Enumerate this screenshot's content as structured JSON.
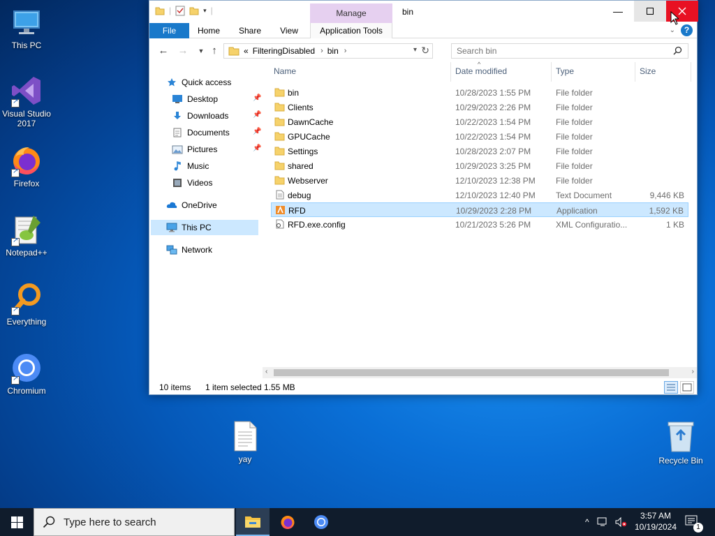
{
  "desktop": {
    "icons": [
      {
        "label": "This PC",
        "icon": "computer-icon"
      },
      {
        "label": "Visual Studio 2017",
        "icon": "visual-studio-icon"
      },
      {
        "label": "Firefox",
        "icon": "firefox-icon"
      },
      {
        "label": "Notepad++",
        "icon": "notepadpp-icon"
      },
      {
        "label": "Everything",
        "icon": "everything-search-icon"
      },
      {
        "label": "Chromium",
        "icon": "chromium-icon"
      }
    ],
    "yay_label": "yay",
    "recycle_label": "Recycle Bin"
  },
  "window": {
    "title": "bin",
    "manage_label": "Manage",
    "tabs": {
      "file": "File",
      "home": "Home",
      "share": "Share",
      "view": "View",
      "app_tools": "Application Tools"
    },
    "help_label": "?",
    "breadcrumb": {
      "prefix": "«",
      "items": [
        "FilteringDisabled",
        "bin"
      ]
    },
    "search_placeholder": "Search bin",
    "nav": {
      "quick_access": "Quick access",
      "desktop": "Desktop",
      "downloads": "Downloads",
      "documents": "Documents",
      "pictures": "Pictures",
      "music": "Music",
      "videos": "Videos",
      "onedrive": "OneDrive",
      "this_pc": "This PC",
      "network": "Network"
    },
    "columns": {
      "name": "Name",
      "date": "Date modified",
      "type": "Type",
      "size": "Size"
    },
    "files": [
      {
        "name": "bin",
        "date": "10/28/2023 1:55 PM",
        "type": "File folder",
        "size": "",
        "icon": "folder-icon"
      },
      {
        "name": "Clients",
        "date": "10/29/2023 2:26 PM",
        "type": "File folder",
        "size": "",
        "icon": "folder-icon"
      },
      {
        "name": "DawnCache",
        "date": "10/22/2023 1:54 PM",
        "type": "File folder",
        "size": "",
        "icon": "folder-icon"
      },
      {
        "name": "GPUCache",
        "date": "10/22/2023 1:54 PM",
        "type": "File folder",
        "size": "",
        "icon": "folder-icon"
      },
      {
        "name": "Settings",
        "date": "10/28/2023 2:07 PM",
        "type": "File folder",
        "size": "",
        "icon": "folder-icon"
      },
      {
        "name": "shared",
        "date": "10/29/2023 3:25 PM",
        "type": "File folder",
        "size": "",
        "icon": "folder-icon"
      },
      {
        "name": "Webserver",
        "date": "12/10/2023 12:38 PM",
        "type": "File folder",
        "size": "",
        "icon": "folder-icon"
      },
      {
        "name": "debug",
        "date": "12/10/2023 12:40 PM",
        "type": "Text Document",
        "size": "9,446 KB",
        "icon": "text-document-icon"
      },
      {
        "name": "RFD",
        "date": "10/29/2023 2:28 PM",
        "type": "Application",
        "size": "1,592 KB",
        "icon": "application-icon",
        "selected": true
      },
      {
        "name": "RFD.exe.config",
        "date": "10/21/2023 5:26 PM",
        "type": "XML Configuratio...",
        "size": "1 KB",
        "icon": "config-file-icon"
      }
    ],
    "status": {
      "items": "10 items",
      "selected": "1 item selected",
      "size": "1.55 MB"
    }
  },
  "taskbar": {
    "search_placeholder": "Type here to search",
    "time": "3:57 AM",
    "date": "10/19/2024",
    "notification_count": "1"
  },
  "colors": {
    "accent": "#1979ca",
    "selection": "#cce8ff",
    "close_red": "#e81123",
    "manage_purple": "#e6d0f0",
    "taskbar": "#101c2c"
  }
}
